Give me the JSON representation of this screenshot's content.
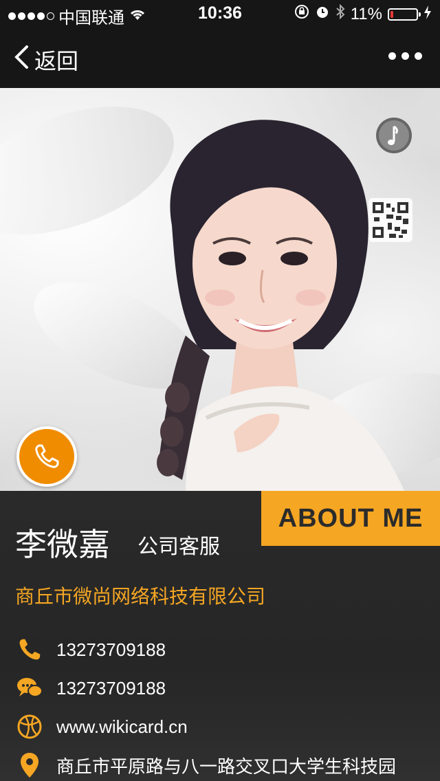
{
  "status_bar": {
    "carrier": "中国联通",
    "time": "10:36",
    "battery": "11%",
    "battery_level": 0.11,
    "signal_bars_filled": 4,
    "signal_bars_total": 5
  },
  "nav": {
    "back_label": "返回"
  },
  "card": {
    "about_label": "ABOUT ME",
    "name": "李微嘉",
    "title": "公司客服",
    "company": "商丘市微尚网络科技有限公司",
    "phone": "13273709188",
    "wechat": "13273709188",
    "website": "www.wikicard.cn",
    "address": "商丘市平原路与八一路交叉口大学生科技园"
  },
  "colors": {
    "accent": "#f5a623",
    "call_button": "#f08c00",
    "battery_low": "#e53935",
    "panel_bg": "#2a2a2a"
  },
  "icons": {
    "status": [
      "wifi-icon",
      "orientation-lock-icon",
      "alarm-icon",
      "bluetooth-icon",
      "battery-icon",
      "charging-icon"
    ],
    "hero": [
      "music-note-icon",
      "qr-code-icon",
      "phone-icon"
    ],
    "contact_rows": [
      "phone-icon",
      "chat-bubbles-icon",
      "globe-icon",
      "location-pin-icon"
    ]
  }
}
